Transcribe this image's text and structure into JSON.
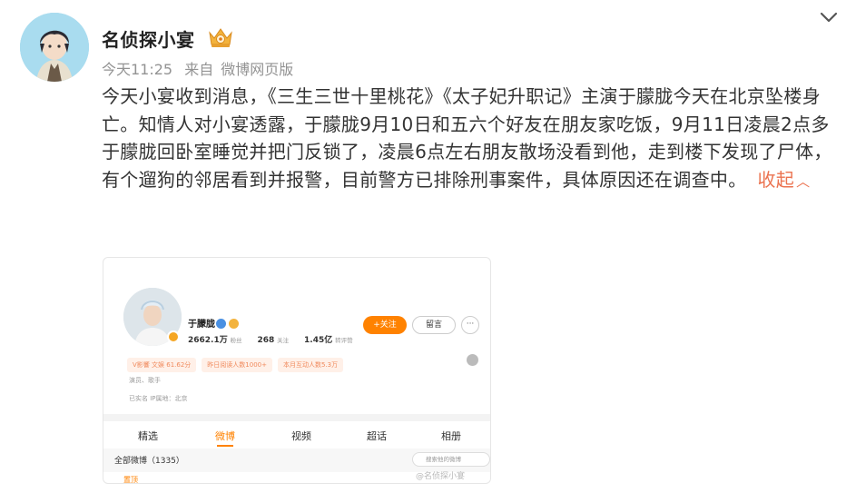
{
  "post": {
    "author": "名侦探小宴",
    "time": "今天11:25",
    "source_prefix": "来自",
    "source": "微博网页版",
    "text": "今天小宴收到消息，《三生三世十里桃花》《太子妃升职记》主演于朦胧今天在北京坠楼身亡。知情人对小宴透露，于朦胧9月10日和五六个好友在朋友家吃饭，9月11日凌晨2点多于朦胧回卧室睡觉并把门反锁了，凌晨6点左右朋友散场没看到他，走到楼下发现了尸体，有个遛狗的邻居看到并报警，目前警方已排除刑事案件，具体原因还在调查中。",
    "collapse_label": "收起",
    "collapse_caret": "︿",
    "accent_color": "#eb7350"
  },
  "embedded_screenshot": {
    "name": "于朦胧",
    "follow_label": "+关注",
    "message_label": "留言",
    "more_label": "···",
    "stats": [
      {
        "value": "2662.1万",
        "label": "粉丝"
      },
      {
        "value": "268",
        "label": "关注"
      },
      {
        "value": "1.45亿",
        "label": "转评赞"
      }
    ],
    "tags": [
      "V影響 文娱 61.62分",
      "昨日阅读人数1000+",
      "本月互动人数5.3万"
    ],
    "info_line_1": "演员、歌手",
    "info_line_2": "已实名   IP属地：北京",
    "tabs": [
      {
        "label": "精选",
        "active": false
      },
      {
        "label": "微博",
        "active": true
      },
      {
        "label": "视频",
        "active": false
      },
      {
        "label": "超话",
        "active": false
      },
      {
        "label": "相册",
        "active": false
      }
    ],
    "filter_label": "全部微博（1335）",
    "search_placeholder": "搜索他的微博",
    "pinned_label": "置顶",
    "watermark": "@名侦探小宴"
  }
}
